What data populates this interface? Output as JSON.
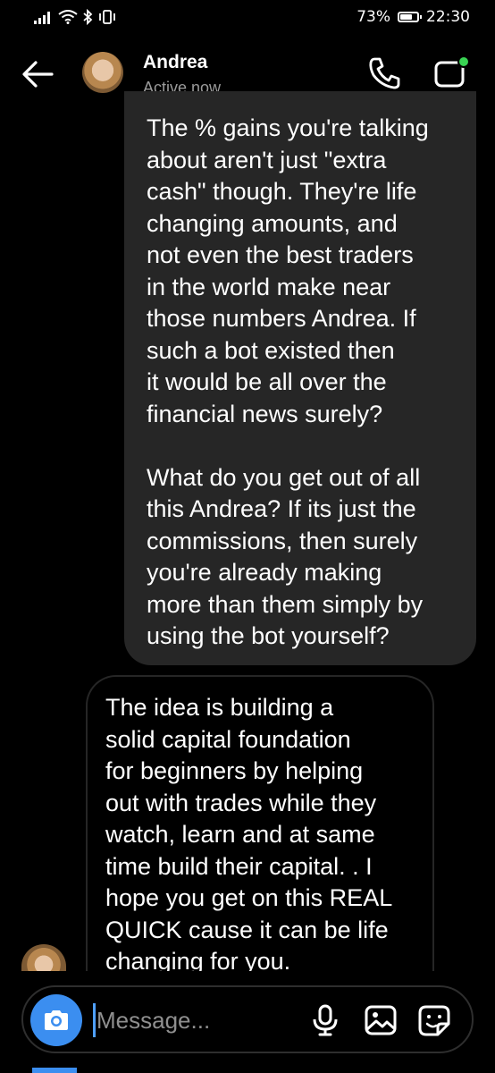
{
  "status_bar": {
    "battery": "73%",
    "time": "22:30",
    "battery_level": 0.73
  },
  "header": {
    "contact_name": "Andrea",
    "contact_status": "Active now"
  },
  "messages": [
    {
      "direction": "sent",
      "text": "The % gains you're talking\nabout aren't just \"extra\ncash\" though. They're life\nchanging amounts, and\nnot even the best traders\nin the world make near\nthose numbers Andrea. If\nsuch a bot existed then\nit would be all over the\nfinancial news surely?\n\nWhat do you get out of all\nthis Andrea? If its just the\ncommissions, then surely\nyou're already making\nmore than them simply by\nusing the bot yourself?"
    },
    {
      "direction": "received",
      "text": "The idea is building a\nsolid capital foundation\nfor beginners by helping\nout with trades while they\nwatch, learn and at same\ntime build their capital. . I\nhope you get on this REAL\nQUICK cause it can be life\nchanging for you."
    }
  ],
  "composer": {
    "placeholder": "Message..."
  },
  "colors": {
    "sent_bubble": "#262626",
    "accent_blue": "#3b8ef0",
    "online_dot": "#39d353"
  }
}
